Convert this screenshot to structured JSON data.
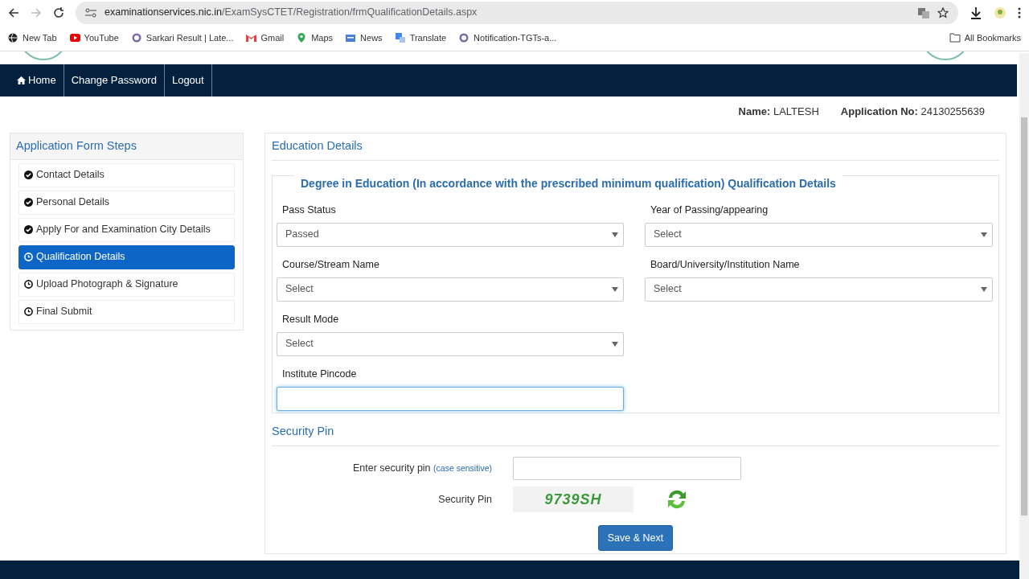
{
  "browser": {
    "url_host": "examinationservices.nic.in",
    "url_path": "/ExamSysCTET/Registration/frmQualificationDetails.aspx",
    "bookmarks": [
      {
        "label": "New Tab"
      },
      {
        "label": "YouTube"
      },
      {
        "label": "Sarkari Result | Late..."
      },
      {
        "label": "Gmail"
      },
      {
        "label": "Maps"
      },
      {
        "label": "News"
      },
      {
        "label": "Translate"
      },
      {
        "label": "Notification-TGTs-a..."
      }
    ],
    "all_bookmarks": "All Bookmarks"
  },
  "nav": [
    {
      "label": "Home",
      "icon": true
    },
    {
      "label": "Change Password",
      "icon": false
    },
    {
      "label": "Logout",
      "icon": false
    }
  ],
  "applicant": {
    "name_label": "Name:",
    "name": "LALTESH",
    "app_label": "Application No:",
    "app_no": "24130255639"
  },
  "steps": {
    "title": "Application Form Steps",
    "items": [
      {
        "label": "Contact Details",
        "kind": "done",
        "selected": false
      },
      {
        "label": "Personal Details",
        "kind": "done",
        "selected": false
      },
      {
        "label": "Apply For and Examination City Details",
        "kind": "done",
        "selected": false
      },
      {
        "label": "Qualification Details",
        "kind": "pending",
        "selected": true
      },
      {
        "label": "Upload Photograph & Signature",
        "kind": "pending",
        "selected": false
      },
      {
        "label": "Final Submit",
        "kind": "pending",
        "selected": false
      }
    ]
  },
  "education": {
    "title": "Education Details",
    "legend": "Degree in Education (In accordance with the prescribed minimum qualification) Qualification Details",
    "fields": [
      {
        "label": "Pass Status",
        "kind": "select",
        "value": "Passed"
      },
      {
        "label": "Year of Passing/appearing",
        "kind": "select",
        "value": "Select"
      },
      {
        "label": "Course/Stream Name",
        "kind": "select",
        "value": "Select"
      },
      {
        "label": "Board/University/Institution Name",
        "kind": "select",
        "value": "Select"
      },
      {
        "label": "Result Mode",
        "kind": "select",
        "value": "Select"
      },
      {
        "label": "Institute Pincode",
        "kind": "text"
      }
    ]
  },
  "security": {
    "title": "Security Pin",
    "enter_label": "Enter security pin",
    "hint": "(case sensitive)",
    "pin_label": "Security Pin",
    "captcha": "9739SH"
  },
  "save_button": "Save & Next"
}
